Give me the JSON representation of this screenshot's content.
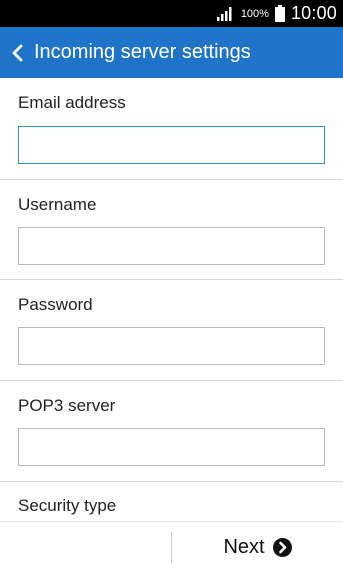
{
  "status_bar": {
    "battery_percent": "100%",
    "time": "10:00",
    "icons": [
      "signal-icon",
      "battery-icon"
    ]
  },
  "header": {
    "title": "Incoming server settings",
    "back_icon": "chevron-left-icon",
    "color": "#1f73c9"
  },
  "form": {
    "email": {
      "label": "Email address",
      "value": ""
    },
    "username": {
      "label": "Username",
      "value": ""
    },
    "password": {
      "label": "Password",
      "value": ""
    },
    "pop3_server": {
      "label": "POP3 server",
      "value": ""
    },
    "security_type": {
      "label": "Security type"
    }
  },
  "footer": {
    "next_label": "Next",
    "next_icon": "arrow-right-circle-icon"
  },
  "colors": {
    "accent": "#1f73c9",
    "focus_border": "#2d8fd5"
  }
}
